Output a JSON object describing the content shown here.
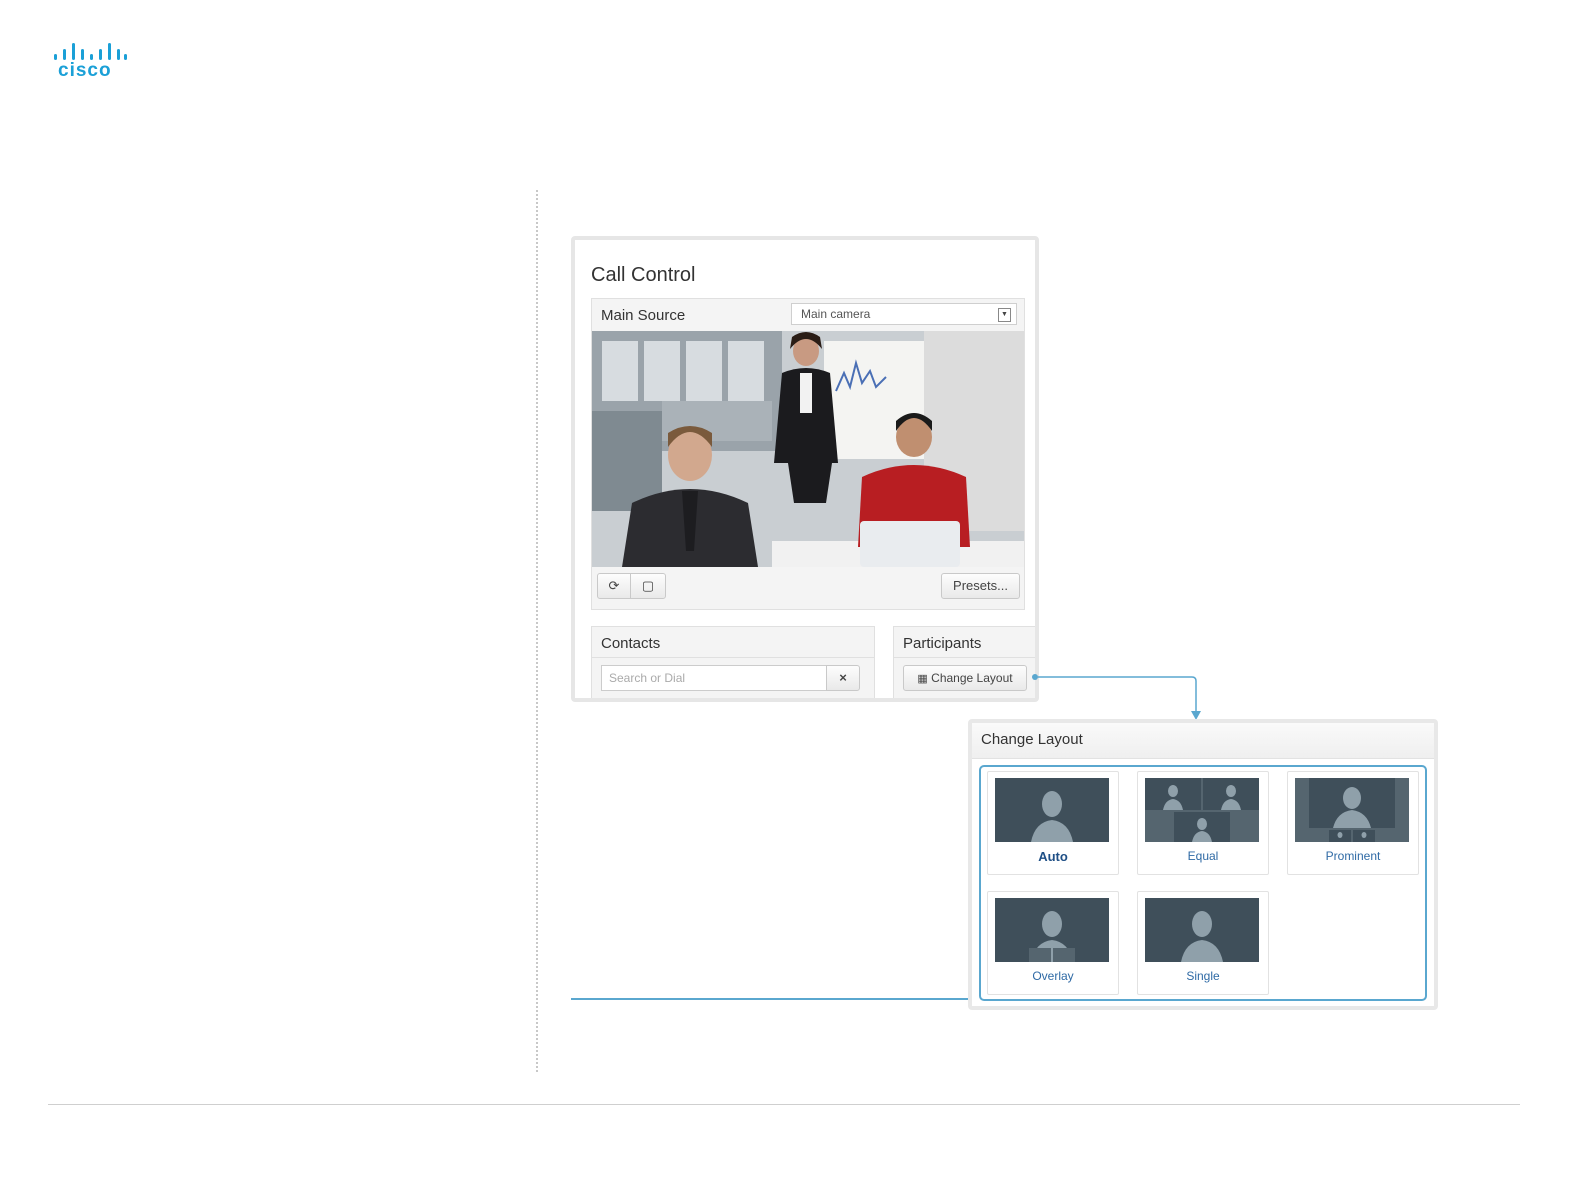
{
  "brand": {
    "name": "cisco"
  },
  "call_control": {
    "title": "Call Control",
    "main_source": {
      "label": "Main Source",
      "selected": "Main camera",
      "presets_label": "Presets..."
    },
    "contacts": {
      "label": "Contacts",
      "search_placeholder": "Search or Dial",
      "clear_icon": "×"
    },
    "participants": {
      "label": "Participants",
      "change_layout_label": "Change Layout"
    }
  },
  "change_layout": {
    "title": "Change Layout",
    "options": [
      {
        "label": "Auto"
      },
      {
        "label": "Equal"
      },
      {
        "label": "Prominent"
      },
      {
        "label": "Overlay"
      },
      {
        "label": "Single"
      }
    ]
  },
  "colors": {
    "brand": "#1ba0d7",
    "accent": "#5aa7cf"
  }
}
